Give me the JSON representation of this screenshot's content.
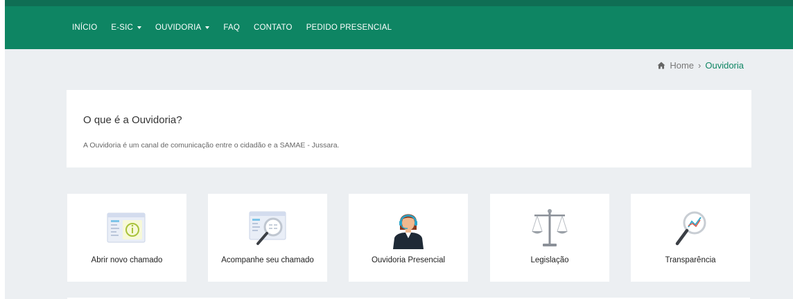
{
  "nav": {
    "items": [
      {
        "label": "INÍCIO",
        "dropdown": false
      },
      {
        "label": "E-SIC",
        "dropdown": true
      },
      {
        "label": "OUVIDORIA",
        "dropdown": true
      },
      {
        "label": "FAQ",
        "dropdown": false
      },
      {
        "label": "CONTATO",
        "dropdown": false
      },
      {
        "label": "PEDIDO PRESENCIAL",
        "dropdown": false
      }
    ]
  },
  "breadcrumb": {
    "home": "Home",
    "separator": "›",
    "current": "Ouvidoria",
    "home_icon": "home-icon"
  },
  "info": {
    "title": "O que é a Ouvidoria?",
    "text": "A Ouvidoria é um canal de comunicação entre o cidadão e a SAMAE - Jussara."
  },
  "tiles": [
    {
      "label": "Abrir novo chamado",
      "icon": "new-ticket-icon"
    },
    {
      "label": "Acompanhe seu chamado",
      "icon": "track-ticket-icon"
    },
    {
      "label": "Ouvidoria Presencial",
      "icon": "attendant-icon"
    },
    {
      "label": "Legislação",
      "icon": "scales-icon"
    },
    {
      "label": "Transparência",
      "icon": "magnifier-chart-icon"
    }
  ],
  "colors": {
    "brand_green": "#0e8563",
    "brand_green_dark": "#0f6e54",
    "page_bg": "#eceff2"
  }
}
